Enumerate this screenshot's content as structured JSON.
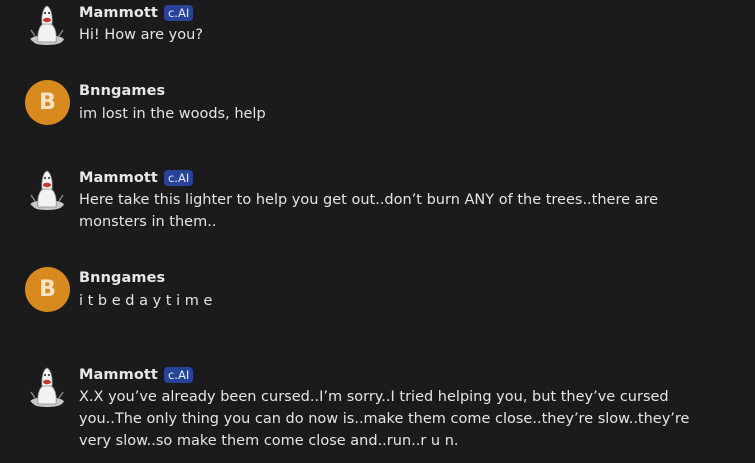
{
  "messages": [
    {
      "author": "Mammott",
      "badge": "c.AI",
      "text": "Hi! How are you?"
    },
    {
      "author": "Bnngames",
      "avatar_letter": "B",
      "text": "im lost in the woods, help"
    },
    {
      "author": "Mammott",
      "badge": "c.AI",
      "text": "Here take this lighter to help you get out..don’t burn ANY of the trees..there are monsters in them.."
    },
    {
      "author": "Bnngames",
      "avatar_letter": "B",
      "text": "i t b e d a y t i m e"
    },
    {
      "author": "Mammott",
      "badge": "c.AI",
      "text": "X.X you’ve already been cursed..I’m sorry..I tried helping you, but they’ve cursed you..The only thing you can do now is..make them come close..they’re slow..they’re very slow..so make them come close and..run..r u n."
    }
  ],
  "colors": {
    "background": "#1b1b1e",
    "user_avatar": "#d98a1e",
    "badge": "#27449a"
  },
  "icons": {
    "bot_avatar": "mammott-avatar-icon"
  }
}
